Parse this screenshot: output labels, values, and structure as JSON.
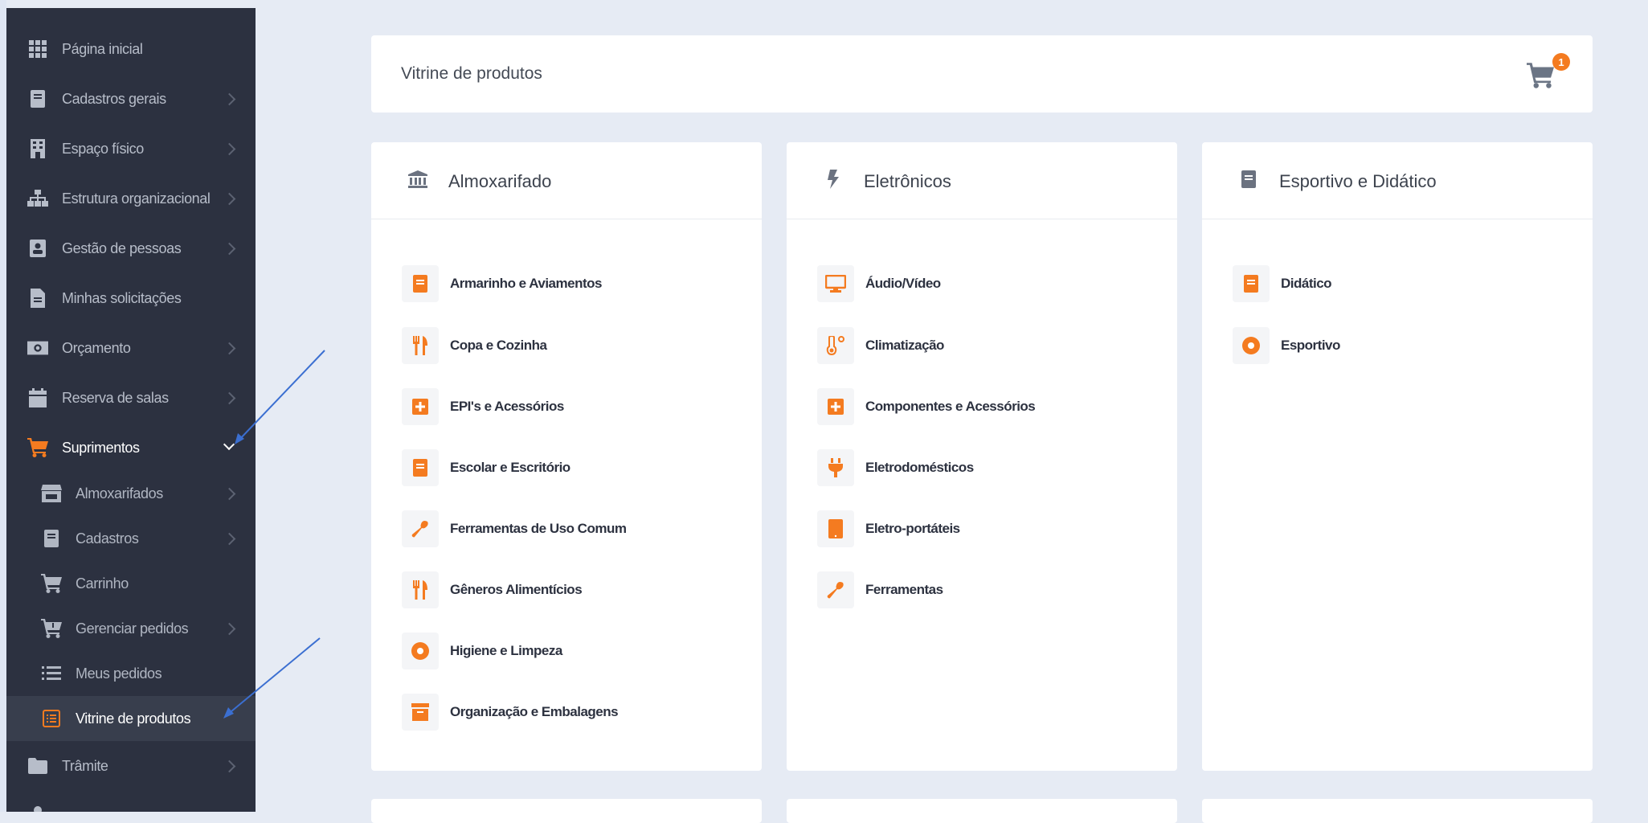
{
  "sidebar": {
    "items": [
      {
        "label": "Página inicial",
        "icon": "grid-icon"
      },
      {
        "label": "Cadastros gerais",
        "icon": "book-icon"
      },
      {
        "label": "Espaço físico",
        "icon": "building-icon"
      },
      {
        "label": "Estrutura organizacional",
        "icon": "sitemap-icon"
      },
      {
        "label": "Gestão de pessoas",
        "icon": "person-badge-icon"
      },
      {
        "label": "Minhas solicitações",
        "icon": "file-icon"
      },
      {
        "label": "Orçamento",
        "icon": "money-icon"
      },
      {
        "label": "Reserva de salas",
        "icon": "calendar-icon"
      },
      {
        "label": "Suprimentos",
        "icon": "cart-icon"
      },
      {
        "label": "Trâmite",
        "icon": "folder-icon"
      }
    ],
    "sub_items": [
      {
        "label": "Almoxarifados",
        "icon": "store-icon"
      },
      {
        "label": "Cadastros",
        "icon": "book-icon"
      },
      {
        "label": "Carrinho",
        "icon": "cart-icon"
      },
      {
        "label": "Gerenciar pedidos",
        "icon": "cart-arrow-icon"
      },
      {
        "label": "Meus pedidos",
        "icon": "list-icon"
      },
      {
        "label": "Vitrine de produtos",
        "icon": "list-alt-icon"
      }
    ]
  },
  "header": {
    "title": "Vitrine de produtos",
    "cart_badge": "1"
  },
  "categories": [
    {
      "title": "Almoxarifado",
      "icon": "bank-icon",
      "items": [
        {
          "label": "Armarinho e Aviamentos",
          "icon": "book-icon"
        },
        {
          "label": "Copa e Cozinha",
          "icon": "utensils-icon"
        },
        {
          "label": "EPI's e Acessórios",
          "icon": "plus-square-icon"
        },
        {
          "label": "Escolar e Escritório",
          "icon": "book-icon"
        },
        {
          "label": "Ferramentas de Uso Comum",
          "icon": "wrench-icon"
        },
        {
          "label": "Gêneros Alimentícios",
          "icon": "utensils-icon"
        },
        {
          "label": "Higiene e Limpeza",
          "icon": "circle-icon"
        },
        {
          "label": "Organização e Embalagens",
          "icon": "archive-icon"
        }
      ]
    },
    {
      "title": "Eletrônicos",
      "icon": "bolt-icon",
      "items": [
        {
          "label": "Áudio/Vídeo",
          "icon": "monitor-icon"
        },
        {
          "label": "Climatização",
          "icon": "thermometer-icon"
        },
        {
          "label": "Componentes e Acessórios",
          "icon": "plus-square-icon"
        },
        {
          "label": "Eletrodomésticos",
          "icon": "plug-icon"
        },
        {
          "label": "Eletro-portáteis",
          "icon": "tablet-icon"
        },
        {
          "label": "Ferramentas",
          "icon": "wrench-icon"
        }
      ]
    },
    {
      "title": "Esportivo e Didático",
      "icon": "book-icon",
      "items": [
        {
          "label": "Didático",
          "icon": "book-icon"
        },
        {
          "label": "Esportivo",
          "icon": "circle-icon"
        }
      ]
    }
  ],
  "colors": {
    "accent": "#f47b20",
    "sidebar_bg": "#2c3140",
    "page_bg": "#e6ebf4",
    "annotation_arrow": "#3b6fd1"
  }
}
